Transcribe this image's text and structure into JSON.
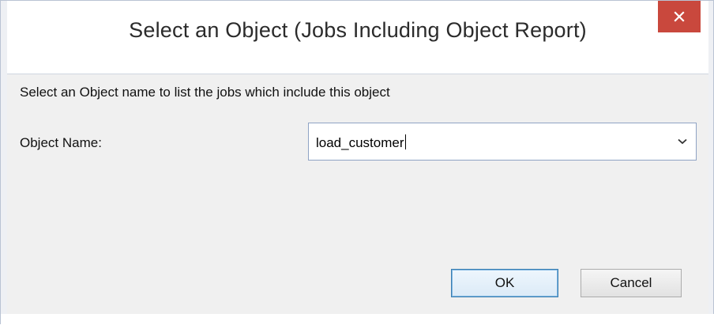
{
  "window": {
    "title": "Select an Object (Jobs Including Object Report)",
    "close_icon": "close-icon"
  },
  "instruction": "Select an Object name to list the jobs which include this object",
  "object_name": {
    "label": "Object Name:",
    "value": "load_customer",
    "dropdown_icon": "chevron-down-icon"
  },
  "buttons": {
    "ok": "OK",
    "cancel": "Cancel"
  },
  "colors": {
    "close_button": "#c9483d",
    "dialog_background": "#f0f0f0",
    "default_button_border": "#3c7fb1"
  }
}
